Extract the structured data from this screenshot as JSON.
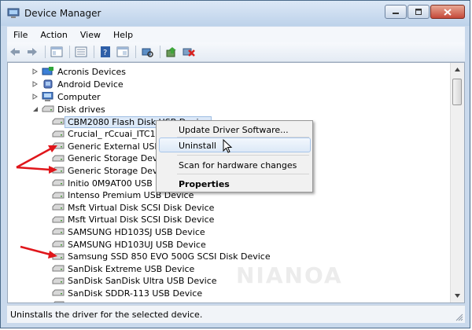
{
  "window": {
    "title": "Device Manager"
  },
  "menu": {
    "items": [
      "File",
      "Action",
      "View",
      "Help"
    ]
  },
  "toolbar": {
    "buttons": [
      "back-icon",
      "forward-icon",
      "properties-pane-icon",
      "device-list-icon",
      "help-icon",
      "show-hidden-icon",
      "scan-hardware-icon",
      "update-driver-icon",
      "uninstall-icon"
    ]
  },
  "tree": {
    "categories": [
      {
        "label": "Acronis Devices",
        "icon": "acronis-icon"
      },
      {
        "label": "Android Device",
        "icon": "android-icon"
      },
      {
        "label": "Computer",
        "icon": "computer-icon"
      },
      {
        "label": "Disk drives",
        "icon": "disk-icon"
      }
    ],
    "disk_drives": [
      "CBM2080 Flash Disk USB Device",
      "Crucial_ rCcuai_ITC15M",
      "Generic External USB De",
      "Generic Storage Device",
      "Generic Storage Device",
      "Initio 0M9AT00 USB Dev",
      "Intenso Premium USB Device",
      "Msft Virtual Disk SCSI Disk Device",
      "Msft Virtual Disk SCSI Disk Device",
      "SAMSUNG HD103SJ USB Device",
      "SAMSUNG HD103UJ USB Device",
      "Samsung SSD 850 EVO 500G SCSI Disk Device",
      "SanDisk Extreme USB Device",
      "SanDisk SanDisk Ultra USB Device",
      "SanDisk SDDR-113 USB Device"
    ]
  },
  "context_menu": {
    "items": [
      "Update Driver Software...",
      "Uninstall",
      "Scan for hardware changes",
      "Properties"
    ],
    "highlighted": "Uninstall"
  },
  "status": {
    "text": "Uninstalls the driver for the selected device."
  },
  "watermark": {
    "text": "NIANOA"
  },
  "colors": {
    "annotation_arrow": "#e0161b",
    "selection": "#dce9f8",
    "title_bar": "#c9d9ec"
  }
}
